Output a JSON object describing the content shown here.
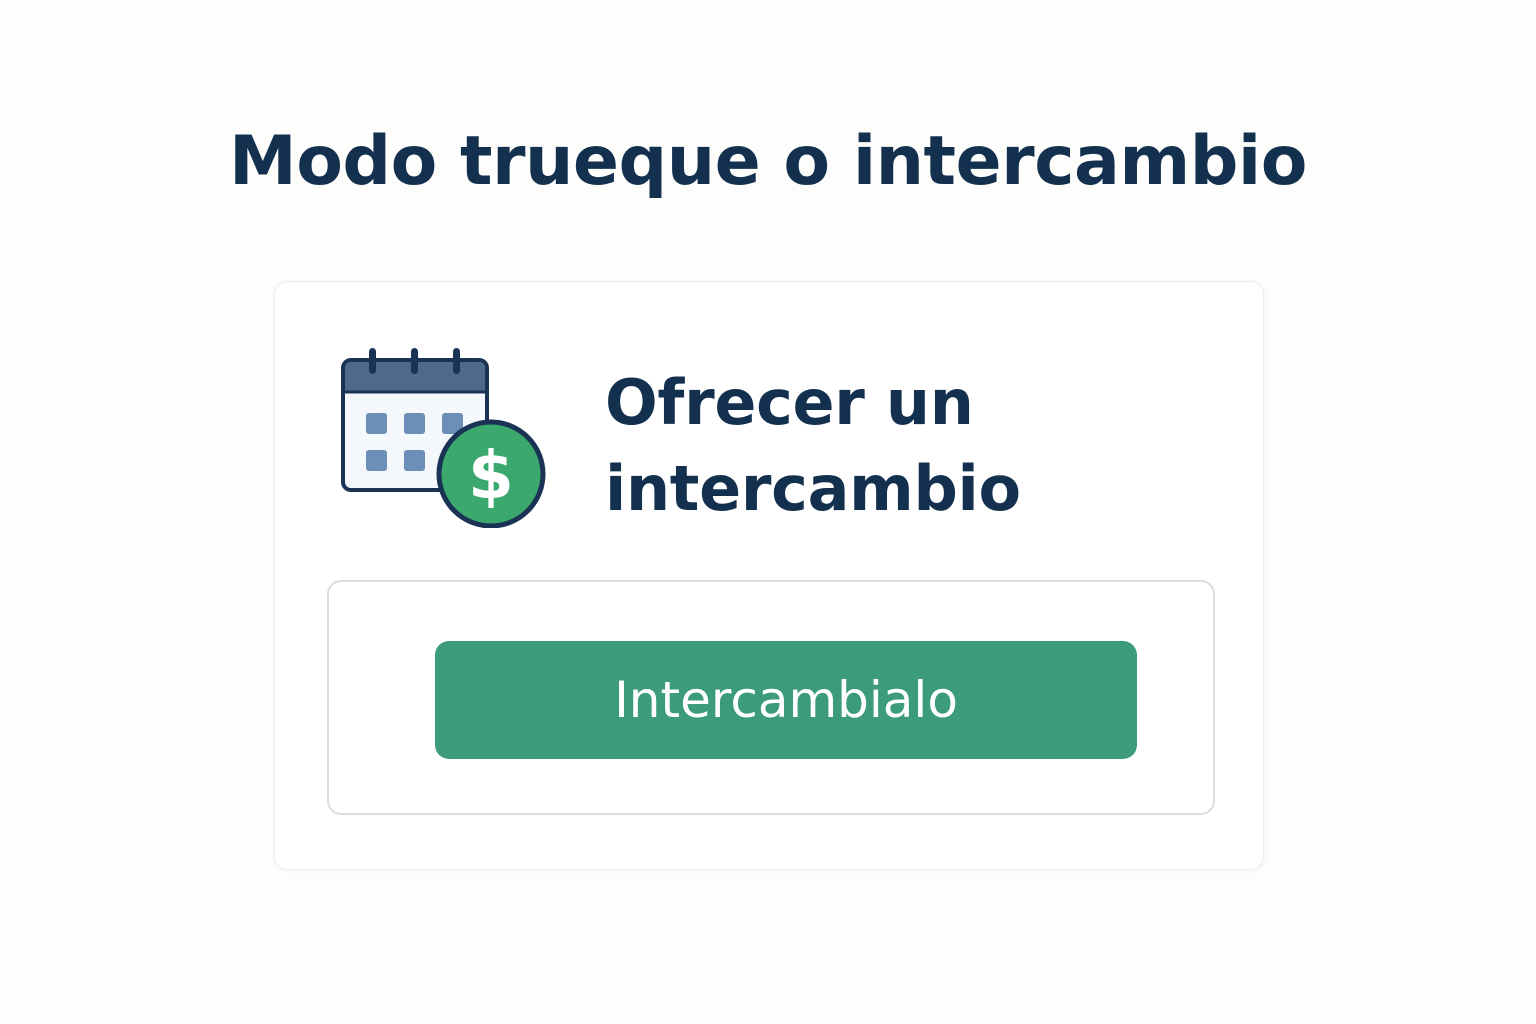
{
  "page": {
    "title": "Modo trueque o intercambio"
  },
  "card": {
    "icon": "calendar-dollar-icon",
    "heading": "Ofrecer un intercambio",
    "button_label": "Intercambialo"
  },
  "colors": {
    "title_text": "#14304f",
    "button_bg": "#3b9b7c",
    "button_text": "#ffffff",
    "coin": "#3ba86e",
    "calendar_header": "#4d6a8c",
    "calendar_cells": "#6b8fb6"
  }
}
